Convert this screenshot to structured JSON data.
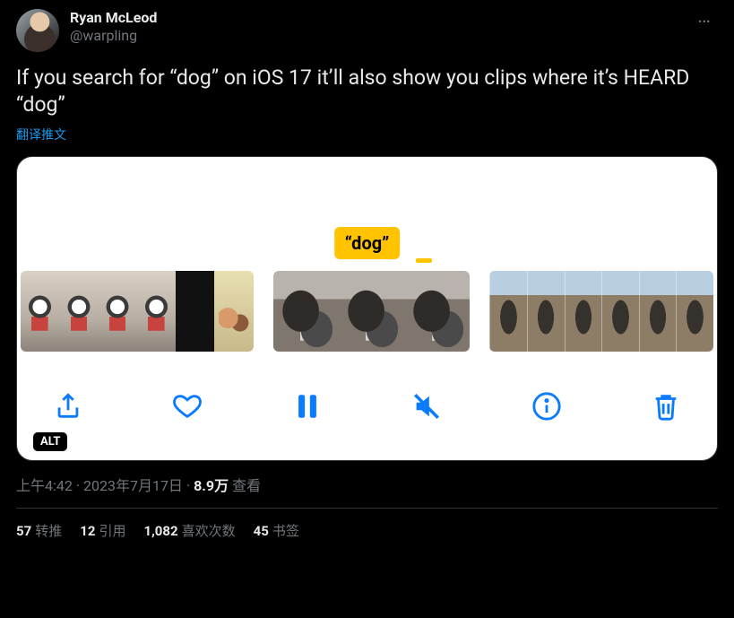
{
  "header": {
    "display_name": "Ryan McLeod",
    "handle": "@warpling"
  },
  "tweet": {
    "text": "If you search for “dog” on iOS 17 it’ll also show you clips where it’s HEARD “dog”",
    "translate_label": "翻译推文"
  },
  "media": {
    "caption": "“dog”",
    "alt_badge": "ALT",
    "toolbar_icons": {
      "share": "share-icon",
      "like": "heart-icon",
      "pause": "pause-icon",
      "mute": "mute-icon",
      "info": "info-icon",
      "delete": "trash-icon"
    }
  },
  "meta": {
    "time": "上午4:42",
    "sep1": " · ",
    "date": "2023年7月17日",
    "sep2": " · ",
    "views_count": "8.9万",
    "views_label": " 查看"
  },
  "stats": {
    "retweets": {
      "count": "57",
      "label": "转推"
    },
    "quotes": {
      "count": "12",
      "label": "引用"
    },
    "likes": {
      "count": "1,082",
      "label": "喜欢次数"
    },
    "bookmarks": {
      "count": "45",
      "label": "书签"
    }
  }
}
